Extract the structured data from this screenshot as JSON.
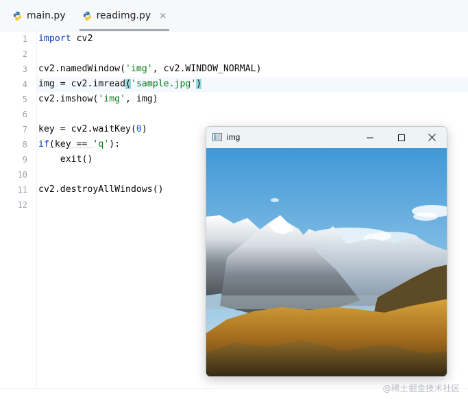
{
  "tabs": [
    {
      "label": "main.py",
      "icon": "python-icon"
    },
    {
      "label": "readimg.py",
      "icon": "python-icon",
      "close": "×",
      "active": true
    }
  ],
  "editor": {
    "line_numbers": [
      "1",
      "2",
      "3",
      "4",
      "5",
      "6",
      "7",
      "8",
      "9",
      "10",
      "11",
      "12"
    ],
    "lines": {
      "l1_kw": "import",
      "l1_rest": " cv2",
      "l3_a": "cv2.namedWindow(",
      "l3_str": "'img'",
      "l3_b": ", cv2.WINDOW_NORMAL)",
      "l4_a": "img = cv2.imread",
      "l4_open": "(",
      "l4_str": "'sample.jpg'",
      "l4_close": ")",
      "l5_a": "cv2.imshow(",
      "l5_str": "'img'",
      "l5_b": ", img)",
      "l7_a": "key = cv2.waitKey(",
      "l7_num": "0",
      "l7_b": ")",
      "l8_kw": "if",
      "l8_a": "(key == ",
      "l8_str": "'q'",
      "l8_b": "):",
      "l9": "    exit()",
      "l11": "cv2.destroyAllWindows()"
    }
  },
  "image_window": {
    "title": "img",
    "minimize": "minimize-icon",
    "maximize": "maximize-icon",
    "close": "close-icon"
  },
  "watermark": "@稀土掘金技术社区",
  "colors": {
    "keyword": "#0033b3",
    "string": "#067d17",
    "number": "#1750eb"
  }
}
